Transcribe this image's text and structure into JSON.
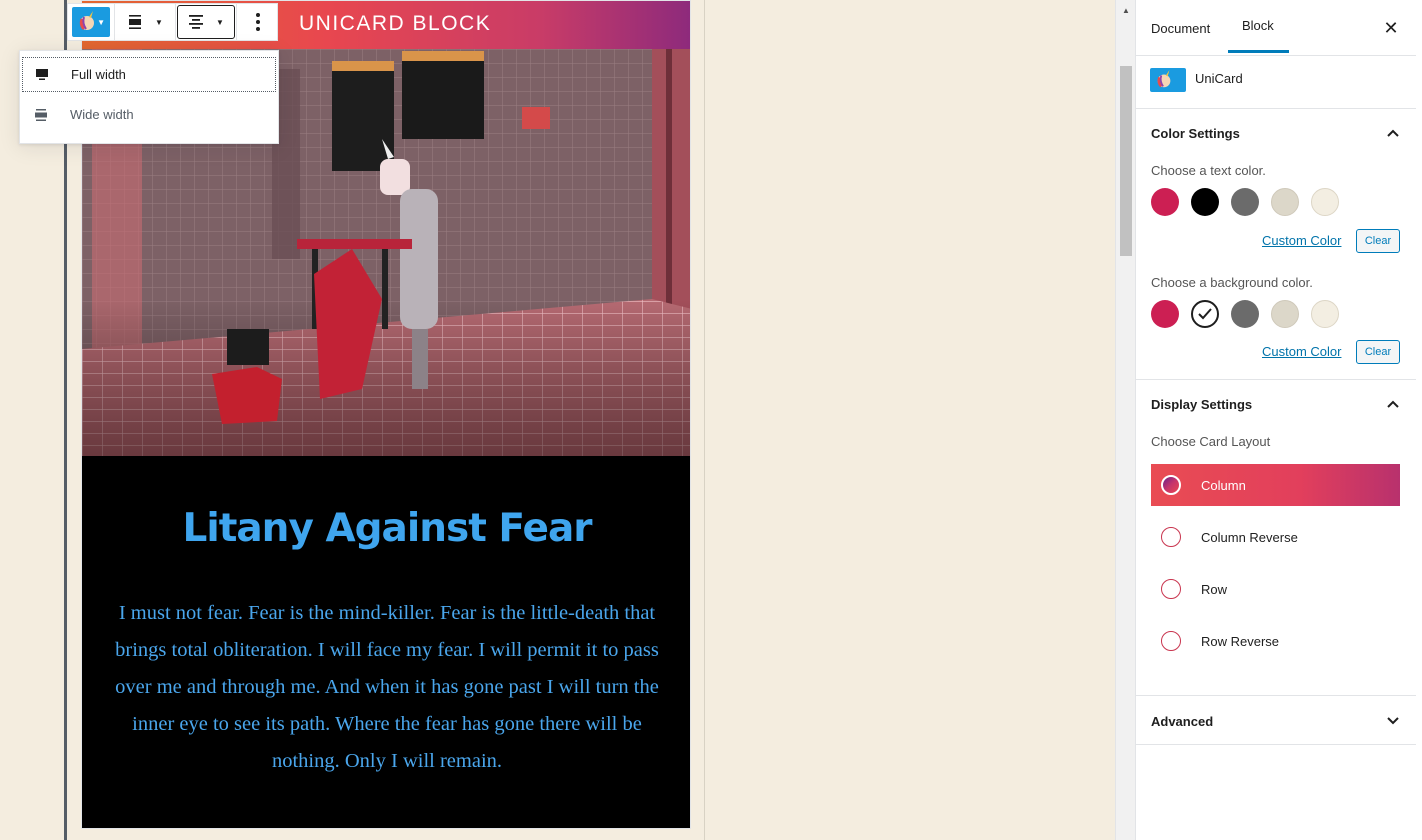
{
  "toolbar": {
    "block_icon": "unicorn-icon",
    "align_icon": "align-wide-icon",
    "content_align_icon": "align-center-icon",
    "more_icon": "more-vertical-icon"
  },
  "alignment_menu": {
    "items": [
      {
        "label": "Full width",
        "icon": "full-width-icon"
      },
      {
        "label": "Wide width",
        "icon": "wide-width-icon"
      }
    ]
  },
  "card": {
    "header_title": "UNICARD BLOCK",
    "title": "Litany Against Fear",
    "text": "I must not fear. Fear is the mind-killer. Fear is the little-death that brings total obliteration. I will face my fear. I will permit it to pass over me and through me. And when it has gone past I will turn the inner eye to see its path. Where the fear has gone there will be nothing. Only I will remain.",
    "title_color": "#3fa5ee",
    "background_color": "#000000"
  },
  "sidebar": {
    "tabs": {
      "document": "Document",
      "block": "Block"
    },
    "close_icon": "close-icon",
    "block_name": "UniCard",
    "color_settings": {
      "title": "Color Settings",
      "text_color_label": "Choose a text color.",
      "background_color_label": "Choose a background color.",
      "palette": [
        "#cc1f53",
        "#000000",
        "#6b6b6b",
        "#dcd7c9",
        "#f3eee2"
      ],
      "selected_background": "#ffffff",
      "custom_color": "Custom Color",
      "clear": "Clear"
    },
    "display_settings": {
      "title": "Display Settings",
      "layout_label": "Choose Card Layout",
      "layouts": [
        "Column",
        "Column Reverse",
        "Row",
        "Row Reverse"
      ],
      "selected_layout": "Column"
    },
    "advanced": {
      "title": "Advanced"
    }
  }
}
